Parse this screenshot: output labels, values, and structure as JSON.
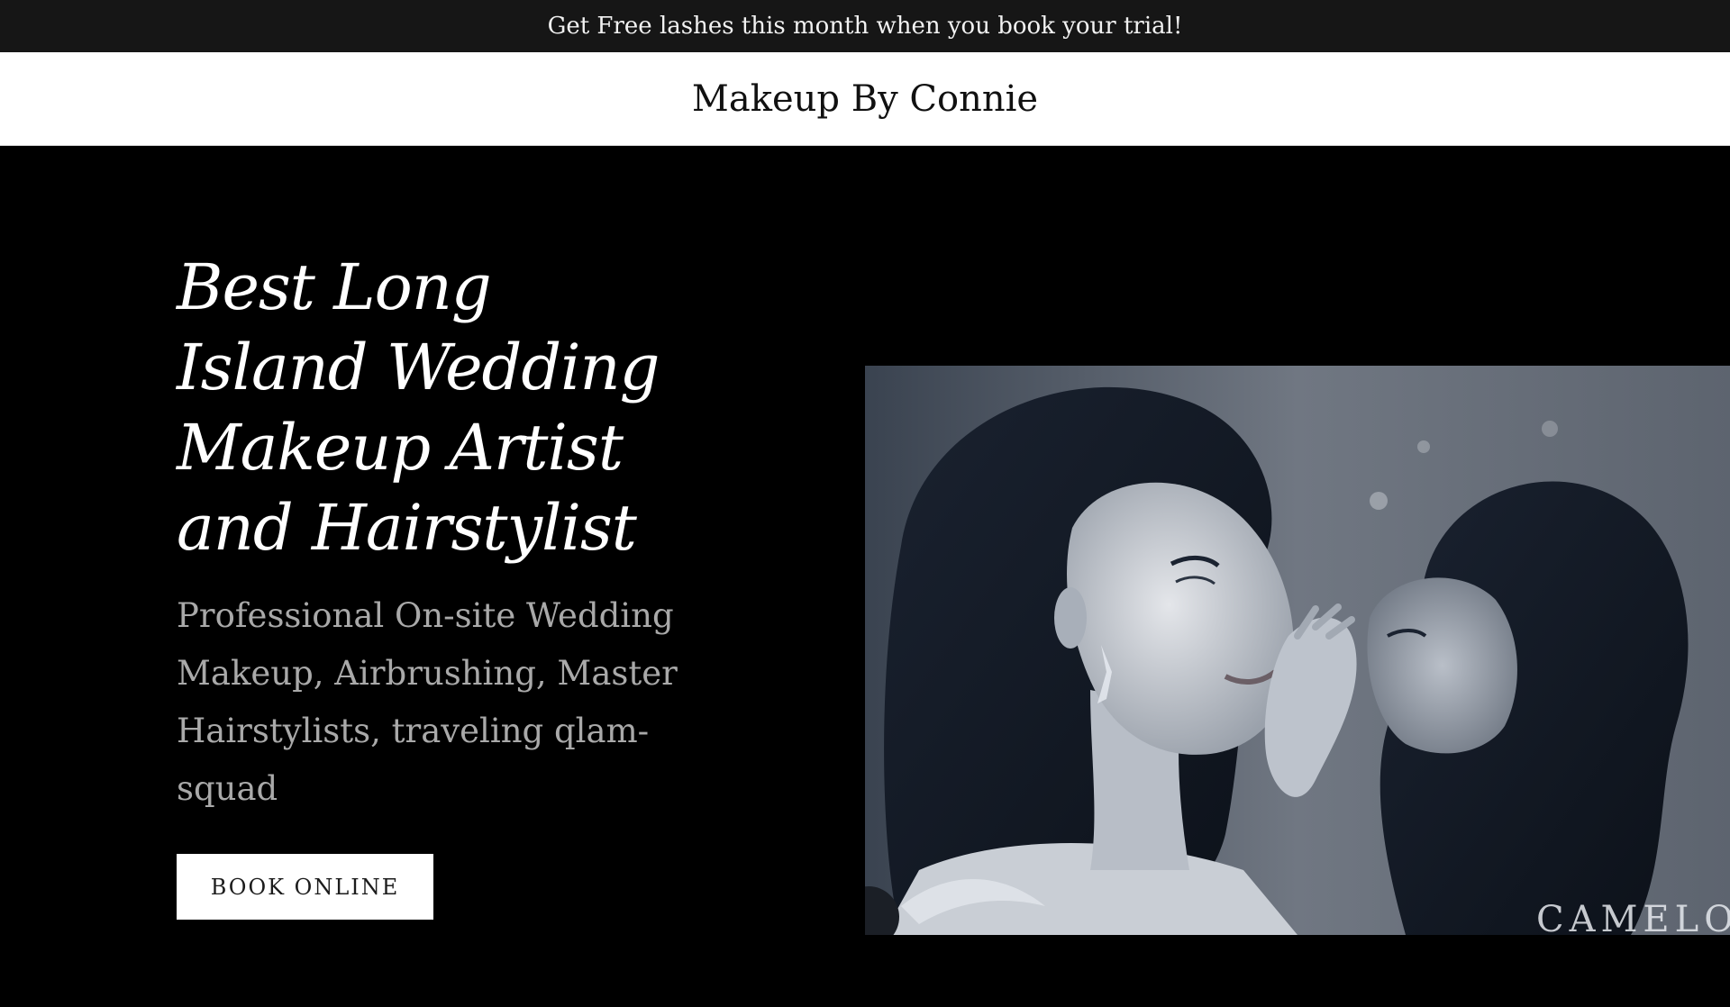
{
  "announcement": {
    "text": "Get Free lashes this month when you book your trial!"
  },
  "header": {
    "site_title": "Makeup By Connie"
  },
  "hero": {
    "heading": "Best Long Island Wedding Makeup Artist and Hairstylist",
    "subtitle": "Professional On-site Wedding Makeup, Airbrushing, Master Hairstylists, traveling qlam-squad",
    "button_label": "BOOK ONLINE",
    "image_watermark": "CAMELO"
  },
  "colors": {
    "announcement_bg": "#161616",
    "header_bg": "#ffffff",
    "hero_bg": "#000000",
    "subtitle_text": "#a9a9a9",
    "button_bg": "#ffffff"
  }
}
